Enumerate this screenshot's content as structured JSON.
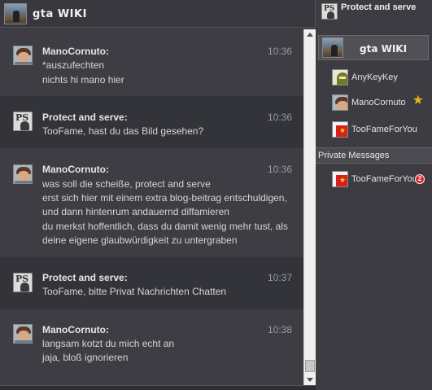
{
  "header": {
    "wiki_title": "gta WIKI",
    "current_user": "Protect and serve"
  },
  "sidebar": {
    "banner_title": "gta WIKI",
    "users": [
      {
        "name": "AnyKeyKey",
        "avatar": "anykey"
      },
      {
        "name": "ManoCornuto",
        "avatar": "mano",
        "badge": "star-icon"
      },
      {
        "name": "TooFameForYou",
        "avatar": "toofame"
      }
    ],
    "private_messages_label": "Private Messages",
    "private_messages": [
      {
        "name": "TooFameForYou",
        "avatar": "toofame",
        "unread": "2"
      }
    ]
  },
  "messages": [
    {
      "author": "ManoCornuto:",
      "time": "10:36",
      "avatar": "mano",
      "lines": [
        "*auszufechten",
        "nichts hi mano hier"
      ]
    },
    {
      "author": "Protect and serve:",
      "time": "10:36",
      "avatar": "ps",
      "lines": [
        "TooFame, hast du das Bild gesehen?"
      ]
    },
    {
      "author": "ManoCornuto:",
      "time": "10:36",
      "avatar": "mano",
      "lines": [
        "was soll die scheiße, protect and serve",
        "erst sich hier mit einem extra blog-beitrag entschuldigen,",
        "und dann hintenrum andauernd diffamieren",
        "du merkst hoffentlich, dass du damit wenig mehr tust, als",
        "deine eigene glaubwürdigkeit zu untergraben"
      ]
    },
    {
      "author": "Protect and serve:",
      "time": "10:37",
      "avatar": "ps",
      "lines": [
        "TooFame, bitte Privat Nachrichten Chatten"
      ]
    },
    {
      "author": "ManoCornuto:",
      "time": "10:38",
      "avatar": "mano",
      "lines": [
        "langsam kotzt du mich echt an",
        "jaja, bloß ignorieren"
      ]
    }
  ]
}
